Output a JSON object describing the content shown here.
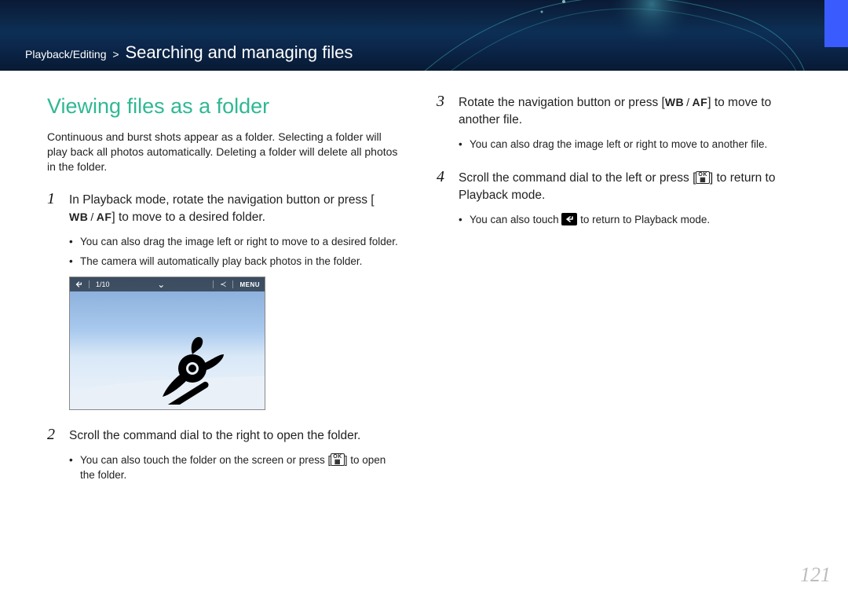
{
  "header": {
    "section": "Playback/Editing",
    "separator": ">",
    "title": "Searching and managing files"
  },
  "section_title": "Viewing files as a folder",
  "intro": "Continuous and burst shots appear as a folder. Selecting a folder will play back all photos automatically. Deleting a folder will delete all photos in the folder.",
  "icons": {
    "wb": "WB",
    "af": "AF",
    "ok_top": "OK",
    "ok_bottom": "▦"
  },
  "steps_col1": [
    {
      "main_before": "In Playback mode, rotate the navigation button or press [",
      "main_after": "] to move to a desired folder.",
      "uses_wb_af": true,
      "subs": [
        "You can also drag the image left or right to move to a desired folder.",
        "The camera will automatically play back photos in the folder."
      ],
      "thumb": {
        "counter": "1/10",
        "menu": "MENU"
      }
    },
    {
      "main_before": "Scroll the command dial to the right to open the folder.",
      "main_after": "",
      "uses_wb_af": false,
      "subs_ok": [
        {
          "before": "You can also touch the folder on the screen or press [",
          "after": "] to open the folder."
        }
      ]
    }
  ],
  "steps_col2": [
    {
      "main_before": "Rotate the navigation button or press [",
      "main_after": "] to move to another file.",
      "uses_wb_af": true,
      "subs": [
        "You can also drag the image left or right to move to another file."
      ]
    },
    {
      "main_before": "Scroll the command dial to the left or press [",
      "main_after": "] to return to Playback mode.",
      "uses_ok": true,
      "subs_back": [
        {
          "before": "You can also touch ",
          "after": " to return to Playback mode."
        }
      ]
    }
  ],
  "page_number": "121"
}
